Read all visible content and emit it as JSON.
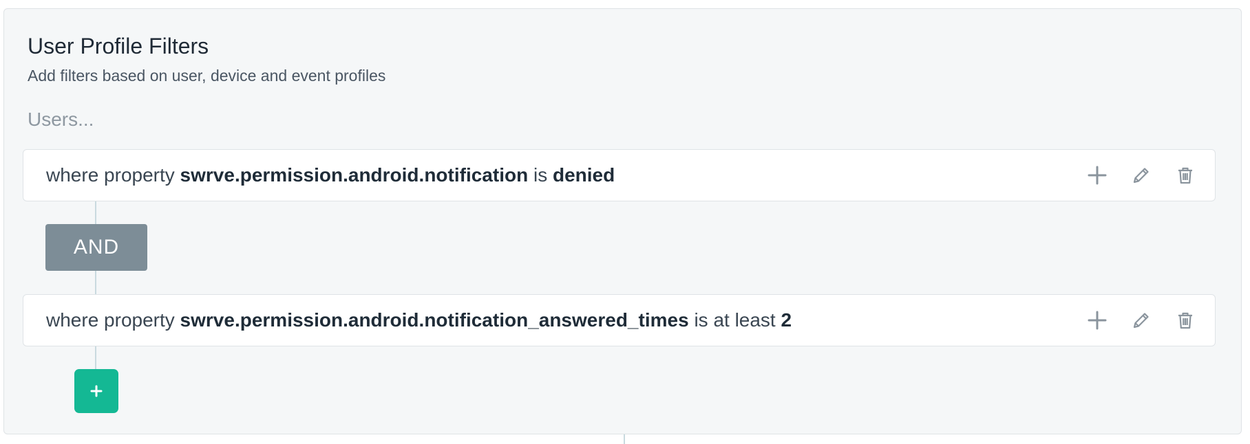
{
  "header": {
    "title": "User Profile Filters",
    "subtitle": "Add filters based on user, device and event profiles"
  },
  "users_label": "Users...",
  "filters": [
    {
      "prefix": "where property",
      "property": "swrve.permission.android.notification",
      "operator": "is",
      "value": "denied"
    },
    {
      "prefix": "where property",
      "property": "swrve.permission.android.notification_answered_times",
      "operator": "is at least",
      "value": "2"
    }
  ],
  "combinator": "AND",
  "add_button_label": "+",
  "colors": {
    "panel_bg": "#f5f7f8",
    "and_badge": "#7d8d97",
    "add_button": "#14b894",
    "icon": "#8a949d"
  },
  "icons": {
    "row_actions": [
      "plus-icon",
      "pencil-icon",
      "trash-icon"
    ]
  }
}
